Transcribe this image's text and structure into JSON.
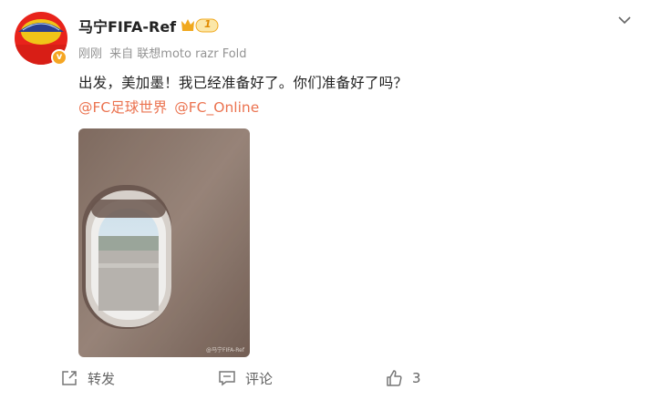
{
  "post": {
    "author": "马宁FIFA-Ref",
    "vip_level": "1",
    "time": "刚刚",
    "source": "来自 联想moto razr Fold",
    "text": "出发，美加墨！我已经准备好了。你们准备好了吗？",
    "mentions": [
      "@FC足球世界",
      "@FC_Online"
    ],
    "image_watermark": "@马宁FIFA-Ref"
  },
  "actions": {
    "repost_label": "转发",
    "comment_label": "评论",
    "like_count": "3"
  },
  "colors": {
    "accent": "#eb7350",
    "meta": "#939393",
    "vip_gold": "#f5a623"
  }
}
